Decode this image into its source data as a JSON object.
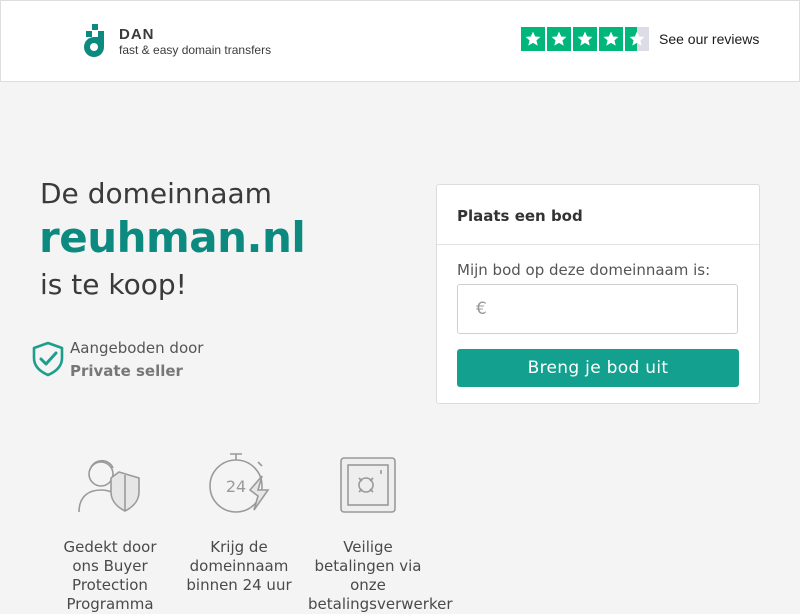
{
  "header": {
    "brand_name": "DAN",
    "brand_tagline": "fast & easy domain transfers",
    "rating": {
      "stars": 4.5,
      "max": 5
    },
    "reviews_link": "See our reviews",
    "colors": {
      "star_green": "#00b67a",
      "star_grey": "#dcdce6"
    }
  },
  "hero": {
    "line1": "De domeinnaam",
    "domain": "reuhman.nl",
    "line3": "is te koop!"
  },
  "seller": {
    "label": "Aangeboden door",
    "name": "Private seller"
  },
  "features": [
    {
      "icon": "buyer-protection-icon",
      "text": "Gedekt door ons Buyer Protection Programma"
    },
    {
      "icon": "stopwatch-24-icon",
      "text": "Krijg de domeinnaam binnen 24 uur"
    },
    {
      "icon": "safe-icon",
      "text": "Veilige betalingen via onze betalingsverwerker"
    }
  ],
  "bid_form": {
    "title": "Plaats een bod",
    "label": "Mijn bod op deze domeinnaam is:",
    "currency": "€",
    "input_value": "",
    "button": "Breng je bod uit"
  },
  "colors": {
    "accent": "#0d8a80",
    "button": "#13a08e",
    "background": "#f4f4f4"
  }
}
